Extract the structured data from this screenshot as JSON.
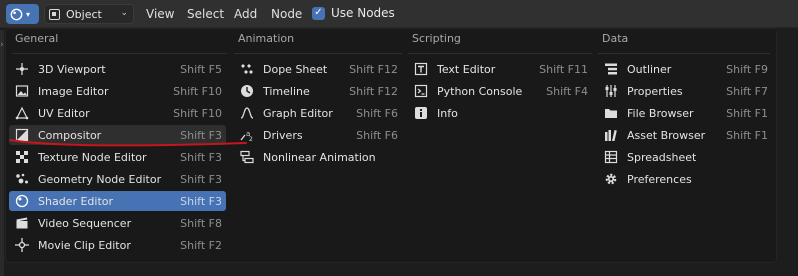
{
  "header": {
    "editor_type_icon": "circle-icon",
    "mode": "Object",
    "menus": [
      "View",
      "Select",
      "Add",
      "Node"
    ],
    "use_nodes": "Use Nodes",
    "accent": "#4772b3"
  },
  "menu": {
    "columns": [
      {
        "title": "General",
        "items": [
          {
            "label": "3D Viewport",
            "shortcut": "Shift F5",
            "icon": "viewport-icon"
          },
          {
            "label": "Image Editor",
            "shortcut": "Shift F10",
            "icon": "image-icon"
          },
          {
            "label": "UV Editor",
            "shortcut": "Shift F10",
            "icon": "uv-icon"
          },
          {
            "label": "Compositor",
            "shortcut": "Shift F3",
            "icon": "compositor-icon"
          },
          {
            "label": "Texture Node Editor",
            "shortcut": "Shift F3",
            "icon": "texture-icon"
          },
          {
            "label": "Geometry Node Editor",
            "shortcut": "Shift F3",
            "icon": "geometry-icon"
          },
          {
            "label": "Shader Editor",
            "shortcut": "Shift F3",
            "icon": "shader-icon"
          },
          {
            "label": "Video Sequencer",
            "shortcut": "Shift F8",
            "icon": "sequencer-icon"
          },
          {
            "label": "Movie Clip Editor",
            "shortcut": "Shift F2",
            "icon": "movieclip-icon"
          }
        ]
      },
      {
        "title": "Animation",
        "items": [
          {
            "label": "Dope Sheet",
            "shortcut": "Shift F12",
            "icon": "dopesheet-icon"
          },
          {
            "label": "Timeline",
            "shortcut": "Shift F12",
            "icon": "timeline-icon"
          },
          {
            "label": "Graph Editor",
            "shortcut": "Shift F6",
            "icon": "graph-icon"
          },
          {
            "label": "Drivers",
            "shortcut": "Shift F6",
            "icon": "drivers-icon"
          },
          {
            "label": "Nonlinear Animation",
            "shortcut": "",
            "icon": "nla-icon"
          }
        ]
      },
      {
        "title": "Scripting",
        "items": [
          {
            "label": "Text Editor",
            "shortcut": "Shift F11",
            "icon": "text-icon"
          },
          {
            "label": "Python Console",
            "shortcut": "Shift F4",
            "icon": "console-icon"
          },
          {
            "label": "Info",
            "shortcut": "",
            "icon": "info-icon"
          }
        ]
      },
      {
        "title": "Data",
        "items": [
          {
            "label": "Outliner",
            "shortcut": "Shift F9",
            "icon": "outliner-icon"
          },
          {
            "label": "Properties",
            "shortcut": "Shift F7",
            "icon": "properties-icon"
          },
          {
            "label": "File Browser",
            "shortcut": "Shift F1",
            "icon": "filebrowser-icon"
          },
          {
            "label": "Asset Browser",
            "shortcut": "Shift F1",
            "icon": "asset-icon"
          },
          {
            "label": "Spreadsheet",
            "shortcut": "",
            "icon": "spreadsheet-icon"
          },
          {
            "label": "Preferences",
            "shortcut": "",
            "icon": "preferences-icon"
          }
        ]
      }
    ],
    "active_item": "Shader Editor",
    "annotation_color": "#c4161c"
  }
}
